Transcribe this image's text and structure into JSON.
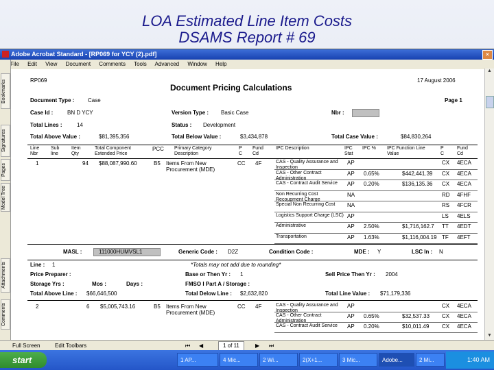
{
  "slide": {
    "title_line1": "LOA Estimated Line Item Costs",
    "title_line2": "DSAMS Report # 69"
  },
  "window": {
    "title": "Adobe Acrobat Standard - [RP069 for YCY (2).pdf]",
    "menu": [
      "File",
      "Edit",
      "View",
      "Document",
      "Comments",
      "Tools",
      "Advanced",
      "Window",
      "Help"
    ],
    "side_tabs": [
      "Bookmarks",
      "Signatures",
      "Pages",
      "Model Tree",
      "Attachments",
      "Comments"
    ]
  },
  "report": {
    "report_id": "RP069",
    "date": "17 August 2006",
    "heading": "Document Pricing Calculations",
    "page": "Page 1",
    "document_type_label": "Document Type :",
    "document_type": "Case",
    "case_id_label": "Case Id :",
    "case_id": "BN D YCY",
    "version_type_label": "Version Type :",
    "version_type": "Basic Case",
    "nbr_label": "Nbr :",
    "total_lines_label": "Total Lines :",
    "total_lines": "14",
    "status_label": "Status :",
    "status": "Development",
    "total_above_label": "Total Above Value :",
    "total_above": "$81,395,356",
    "total_below_label": "Total Below Value :",
    "total_below": "$3,434,878",
    "total_case_label": "Total Case Value :",
    "total_case": "$84,830,264",
    "columns": [
      "Line Nbr",
      "Sub line",
      "Item Qty",
      "Total Component Extended Price",
      "PCC",
      "Primary Category Description",
      "P C",
      "Fund Cd",
      "IPC Description",
      "IPC Stat",
      "IPC %",
      "IPC Function Line Value",
      "P C",
      "Fund Cd"
    ],
    "line1": {
      "nbr": "1",
      "qty": "94",
      "price": "$88,087,990.60",
      "pcc": "B5",
      "desc": "Items From New Procurement (MDE)",
      "pc": "CC",
      "fund": "4F"
    },
    "ipc_rows1": [
      {
        "desc": "CAS - Quality Assurance and Inspection",
        "stat": "AP",
        "pct": "",
        "value": "",
        "pc": "CX",
        "fund": "4ECA"
      },
      {
        "desc": "CAS - Other Contract Administration",
        "stat": "AP",
        "pct": "0.65%",
        "value": "$442,441.39",
        "pc": "CX",
        "fund": "4ECA"
      },
      {
        "desc": "CAS - Contract Audit Service",
        "stat": "AP",
        "pct": "0.20%",
        "value": "$136,135.36",
        "pc": "CX",
        "fund": "4ECA"
      },
      {
        "desc": "Non Recurring Cost Recoupment Charge",
        "stat": "NA",
        "pct": "",
        "value": "",
        "pc": "RD",
        "fund": "4FHF"
      },
      {
        "desc": "Special Non Recurring Cost",
        "stat": "NA",
        "pct": "",
        "value": "",
        "pc": "RS",
        "fund": "4FCR"
      },
      {
        "desc": "Logistics Support Charge (LSC)",
        "stat": "AP",
        "pct": "",
        "value": "",
        "pc": "LS",
        "fund": "4ELS"
      },
      {
        "desc": "Administrative",
        "stat": "AP",
        "pct": "2.50%",
        "value": "$1,716,162.7",
        "pc": "TT",
        "fund": "4EDT"
      },
      {
        "desc": "Transportation",
        "stat": "AP",
        "pct": "1.63%",
        "value": "$1,116,004.19",
        "pc": "TF",
        "fund": "4EFT"
      }
    ],
    "masl_label": "MASL :",
    "masl": "111000HUMVSL1",
    "generic_code_label": "Generic Code :",
    "generic_code": "D2Z",
    "condition_code_label": "Condition Code :",
    "mde_label": "MDE :",
    "mde": "Y",
    "lsc_label": "LSC In :",
    "lsc": "N",
    "line_label": "Line :",
    "line_value": "1",
    "totals_note": "*Totals may not add due to rounding*",
    "price_preparer_label": "Price Preparer :",
    "base_later_label": "Base or Then Yr :",
    "base_later": "1",
    "sell_price_label": "Sell Price Then Yr :",
    "sell_price": "2004",
    "storage_label": "Storage Yrs :",
    "mos_label": "Mos :",
    "days_label": "Days :",
    "fmso_label": "FMSO I Part A / Storage :",
    "total_above_line_label": "Total Above Line :",
    "total_above_line": "$66,646,500",
    "total_below_line_label": "Total Delow Line :",
    "total_below_line": "$2,632,820",
    "total_line_value_label": "Total Line Value :",
    "total_line_value": "$71,179,336",
    "line2": {
      "nbr": "2",
      "qty": "6",
      "price": "$5,005,743.16",
      "pcc": "B5",
      "desc": "Items From New Procurement (MDE)",
      "pc": "CC",
      "fund": "4F"
    },
    "ipc_rows2": [
      {
        "desc": "CAS - Quality Assurance and Inspection",
        "stat": "AP",
        "pct": "",
        "value": "",
        "pc": "CX",
        "fund": "4ECA"
      },
      {
        "desc": "CAS - Other Contract Administration",
        "stat": "AP",
        "pct": "0.65%",
        "value": "$32,537.33",
        "pc": "CX",
        "fund": "4ECA"
      },
      {
        "desc": "CAS - Contract Audit Service",
        "stat": "AP",
        "pct": "0.20%",
        "value": "$10,011.49",
        "pc": "CX",
        "fund": "4ECA"
      }
    ]
  },
  "statusbar": {
    "fullscreen": "Full Screen",
    "toolbars": "Edit Toolbars",
    "page_indicator": "1 of 11"
  },
  "taskbar": {
    "start": "start",
    "buttons": [
      "1 AP...",
      "4 Mic...",
      "2 Wi...",
      "2(X+1...",
      "3 Mic...",
      "Adobe...",
      "2 Mi..."
    ],
    "clock": "1:40 AM"
  }
}
